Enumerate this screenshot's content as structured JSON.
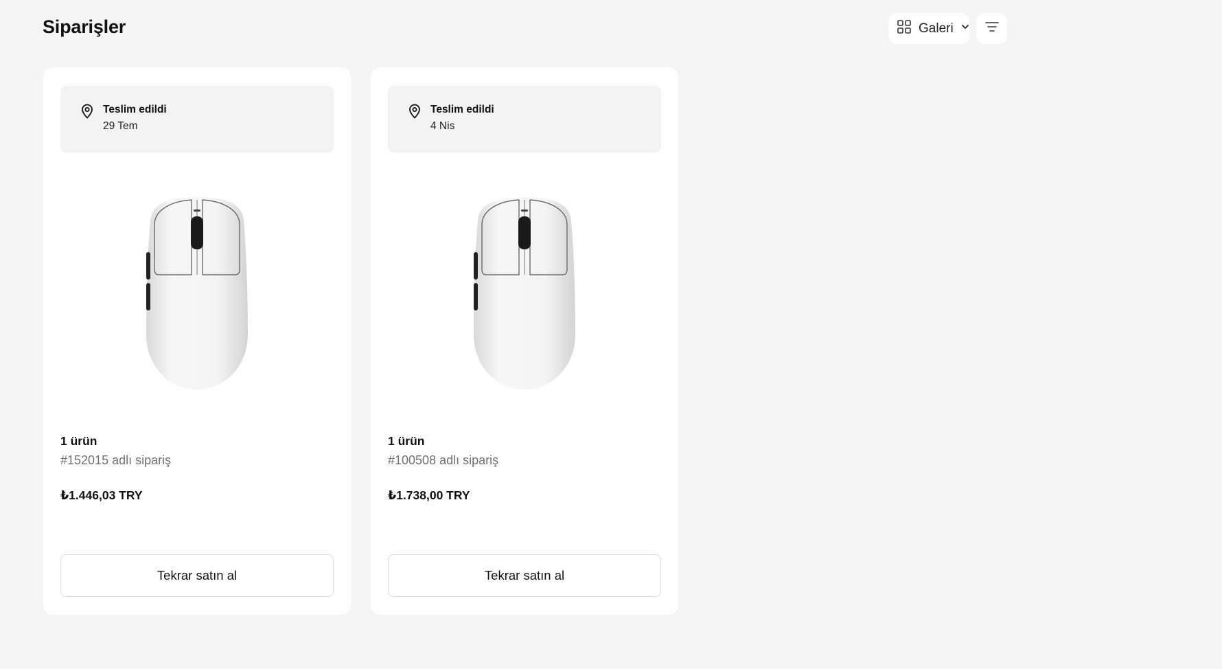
{
  "header": {
    "title": "Siparişler",
    "view_selector": {
      "label": "Galeri",
      "icon": "grid-icon"
    },
    "filter_icon": "filter-icon"
  },
  "orders": [
    {
      "status": "Teslim edildi",
      "date": "29 Tem",
      "items_count": "1 ürün",
      "order_number": "#152015 adlı sipariş",
      "price": "₺1.446,03 TRY",
      "button_label": "Tekrar satın al",
      "product_icon": "white-computer-mouse"
    },
    {
      "status": "Teslim edildi",
      "date": "4 Nis",
      "items_count": "1 ürün",
      "order_number": "#100508 adlı sipariş",
      "price": "₺1.738,00 TRY",
      "button_label": "Tekrar satın al",
      "product_icon": "white-computer-mouse"
    }
  ],
  "colors": {
    "background": "#f5f5f5",
    "card": "#ffffff",
    "status_box": "#f3f3f3",
    "muted_text": "#707070",
    "button_border": "#dcdcdc"
  }
}
